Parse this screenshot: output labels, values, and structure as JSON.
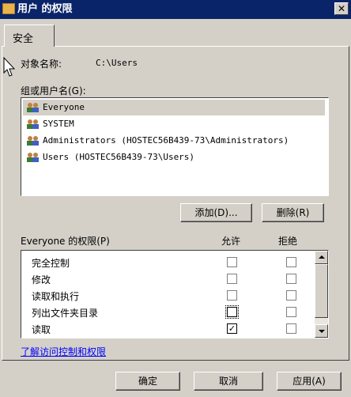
{
  "window": {
    "title": "用户 的权限",
    "close_glyph": "✕"
  },
  "tabs": [
    {
      "label": "安全"
    }
  ],
  "object": {
    "label": "对象名称:",
    "value": "C:\\Users"
  },
  "group_list": {
    "label": "组或用户名(G):",
    "items": [
      {
        "name": "Everyone",
        "selected": true
      },
      {
        "name": "SYSTEM"
      },
      {
        "name": "Administrators (HOSTEC56B439-73\\Administrators)"
      },
      {
        "name": "Users (HOSTEC56B439-73\\Users)"
      }
    ],
    "add_label": "添加(D)...",
    "remove_label": "删除(R)"
  },
  "permissions": {
    "label": "Everyone 的权限(P)",
    "allow_header": "允许",
    "deny_header": "拒绝",
    "rows": [
      {
        "label": "完全控制",
        "allow": false,
        "deny": false
      },
      {
        "label": "修改",
        "allow": false,
        "deny": false
      },
      {
        "label": "读取和执行",
        "allow": false,
        "deny": false
      },
      {
        "label": "列出文件夹目录",
        "allow": false,
        "deny": false
      },
      {
        "label": "读取",
        "allow": true,
        "deny": false
      }
    ],
    "check_glyph": "✓"
  },
  "help_link": "了解访问控制和权限",
  "footer": {
    "ok_label": "确定",
    "cancel_label": "取消",
    "apply_label": "应用(A)"
  }
}
